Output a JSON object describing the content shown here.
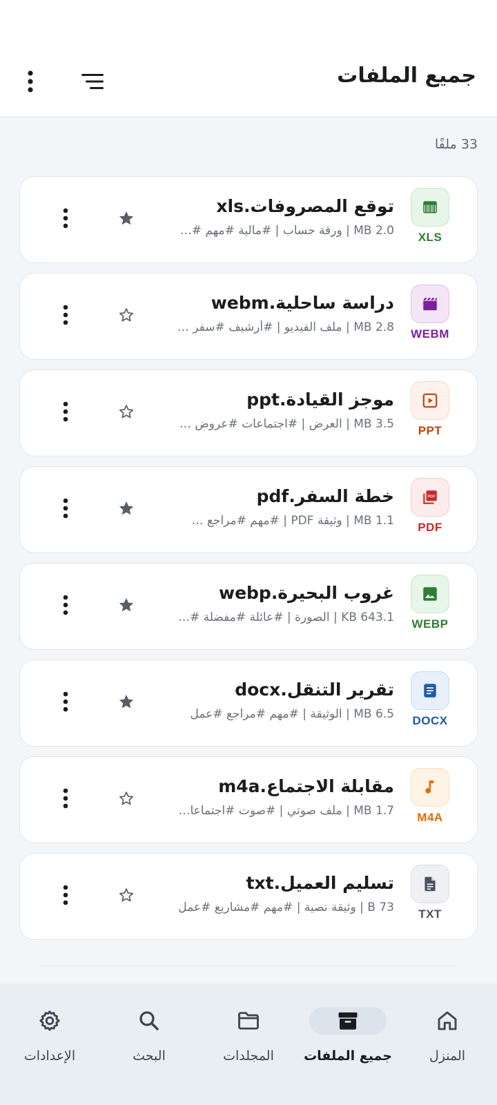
{
  "header": {
    "title": "جميع الملفات"
  },
  "file_count": "33 ملفًا",
  "files": [
    {
      "name": "توقع المصروفات.xls",
      "meta": "2.0 MB | ورقة حساب | #مالية  #مهم  #…",
      "type": "XLS",
      "icon": "spreadsheet-icon",
      "starred": true,
      "color": "#2e7d32",
      "bg": "#e8f5e9",
      "border": "#c8e6c9"
    },
    {
      "name": "دراسة ساحلية.webm",
      "meta": "2.8 MB | ملف الفيديو | #أرشيف  #سفر  …",
      "type": "WEBM",
      "icon": "video-icon",
      "starred": false,
      "color": "#7b1fa2",
      "bg": "#f3e5f5",
      "border": "#e1bee7"
    },
    {
      "name": "موجز القيادة.ppt",
      "meta": "3.5 MB | العرض | #اجتماعات  #عروض  …",
      "type": "PPT",
      "icon": "presentation-icon",
      "starred": false,
      "color": "#c2410c",
      "bg": "#fff1ec",
      "border": "#ffd5c6"
    },
    {
      "name": "خطة السفر.pdf",
      "meta": "1.1 MB | وثيقة PDF | #مهم  #مراجع  …",
      "type": "PDF",
      "icon": "pdf-icon",
      "starred": true,
      "color": "#c62828",
      "bg": "#fdecec",
      "border": "#f7c9c9"
    },
    {
      "name": "غروب البحيرة.webp",
      "meta": "643.1 KB | الصورة | #عائلة  #مفضلة  #…",
      "type": "WEBP",
      "icon": "image-icon",
      "starred": true,
      "color": "#2e7d32",
      "bg": "#e8f5e9",
      "border": "#c8e6c9"
    },
    {
      "name": "تقرير التنقل.docx",
      "meta": "6.5 MB | الوثيقة | #مهم  #مراجع  #عمل",
      "type": "DOCX",
      "icon": "document-icon",
      "starred": true,
      "color": "#1e5aa8",
      "bg": "#e8f0fb",
      "border": "#c8dbf5"
    },
    {
      "name": "مقابلة الاجتماع.m4a",
      "meta": "1.7 MB | ملف صوتي | #صوت  #اجتماعا…",
      "type": "M4A",
      "icon": "audio-icon",
      "starred": false,
      "color": "#e06c00",
      "bg": "#fff3e6",
      "border": "#ffdcb8"
    },
    {
      "name": "تسليم العميل.txt",
      "meta": "73 B | وثيقة نصية | #مهم  #مشاريع  #عمل",
      "type": "TXT",
      "icon": "text-file-icon",
      "starred": false,
      "color": "#4a5260",
      "bg": "#eef0f3",
      "border": "#d9dde2"
    }
  ],
  "nav": [
    {
      "label": "المنزل",
      "icon": "home-icon",
      "active": false
    },
    {
      "label": "جميع الملفات",
      "icon": "archive-icon",
      "active": true
    },
    {
      "label": "المجلدات",
      "icon": "folder-icon",
      "active": false
    },
    {
      "label": "البحث",
      "icon": "search-icon",
      "active": false
    },
    {
      "label": "الإعدادات",
      "icon": "settings-icon",
      "active": false
    }
  ]
}
